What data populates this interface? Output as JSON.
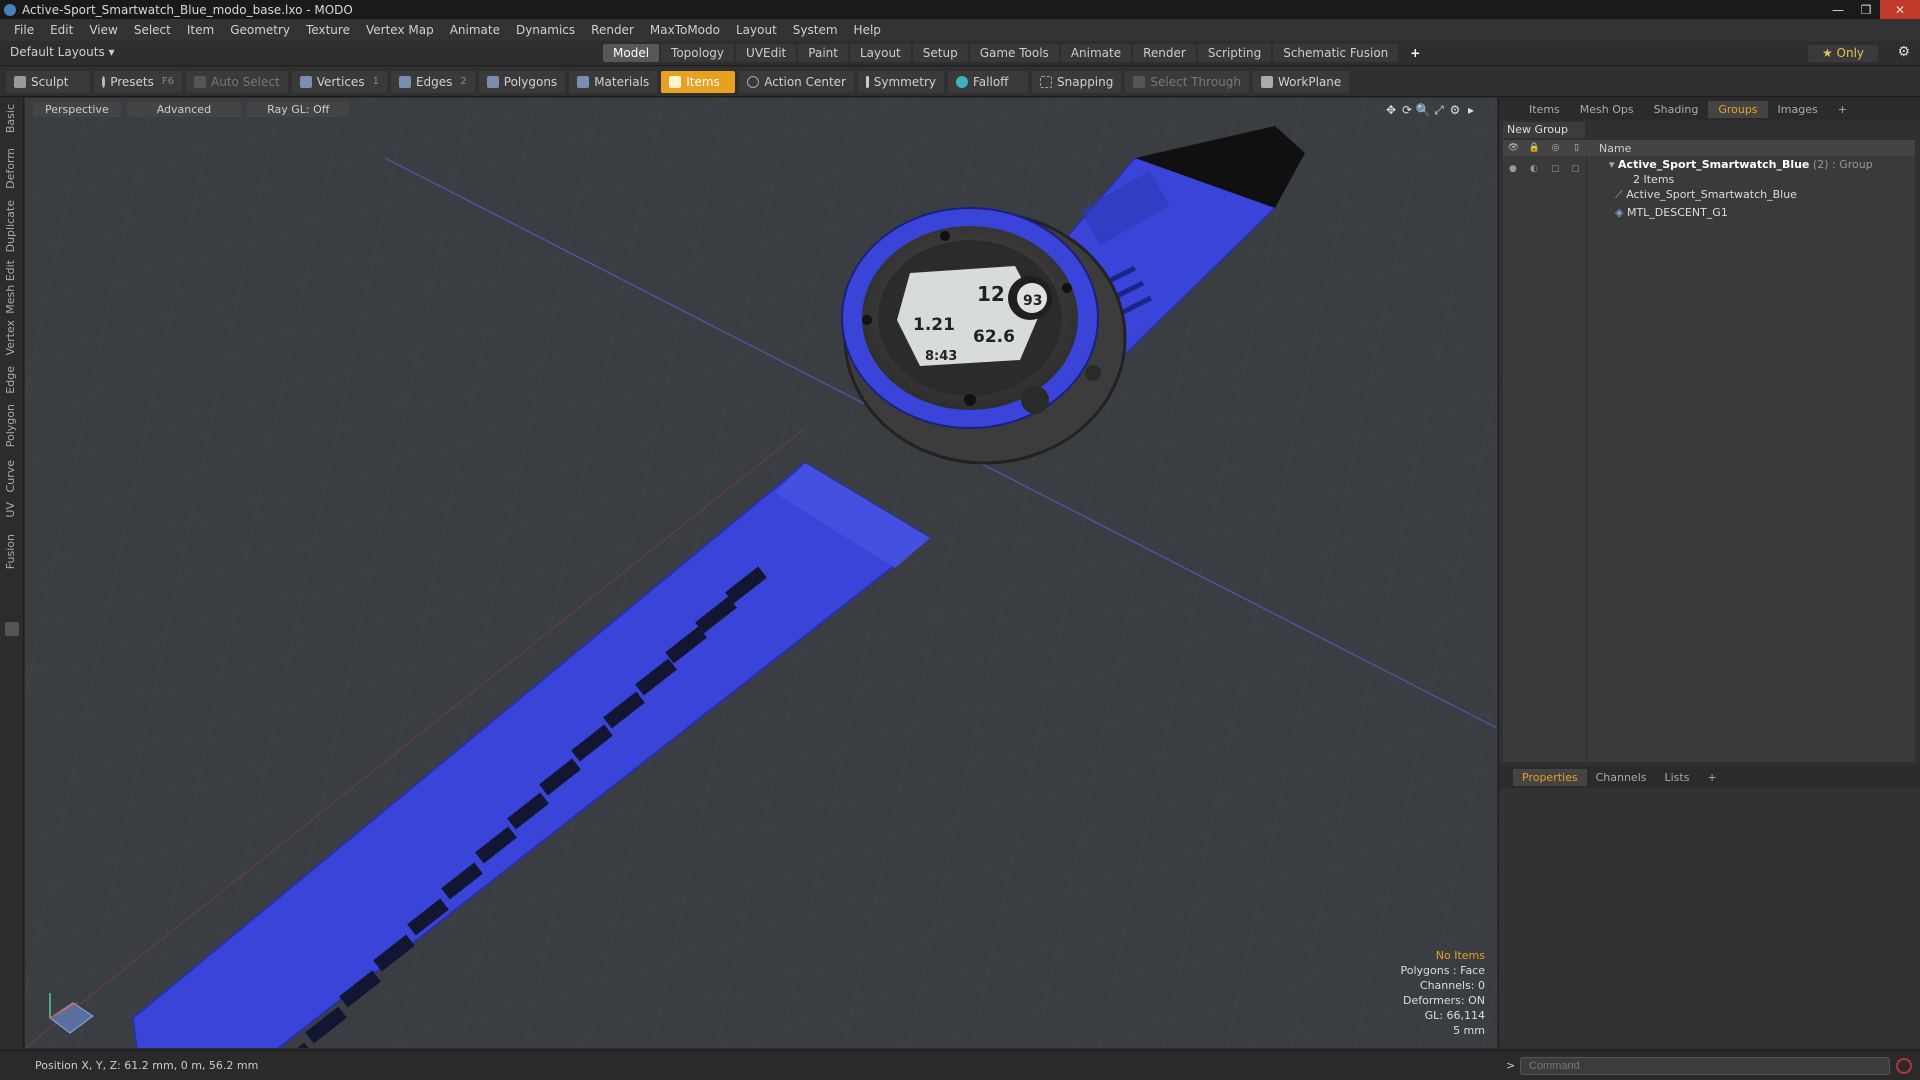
{
  "window": {
    "title": "Active-Sport_Smartwatch_Blue_modo_base.lxo - MODO",
    "controls": [
      "—",
      "❐",
      "✕"
    ]
  },
  "menu": [
    "File",
    "Edit",
    "View",
    "Select",
    "Item",
    "Geometry",
    "Texture",
    "Vertex Map",
    "Animate",
    "Dynamics",
    "Render",
    "MaxToModo",
    "Layout",
    "System",
    "Help"
  ],
  "layout_bar": {
    "layout_select": "Default Layouts ▾",
    "tabs": [
      "Model",
      "Topology",
      "UVEdit",
      "Paint",
      "Layout",
      "Setup",
      "Game Tools",
      "Animate",
      "Render",
      "Scripting",
      "Schematic Fusion"
    ],
    "active_tab": "Model",
    "add_tab": "+",
    "only_label": "★ Only",
    "gear": "⚙"
  },
  "toolbar": {
    "sculpt": "Sculpt",
    "presets": "Presets",
    "presets_key": "F6",
    "auto_select": "Auto Select",
    "vertices": "Vertices",
    "vertices_count": "1",
    "edges": "Edges",
    "edges_count": "2",
    "polygons": "Polygons",
    "materials": "Materials",
    "items": "Items",
    "action_center": "Action Center",
    "symmetry": "Symmetry",
    "falloff": "Falloff",
    "snapping": "Snapping",
    "select_through": "Select Through",
    "workplane": "WorkPlane"
  },
  "left_tabs": [
    "Basic",
    "Deform",
    "Duplicate",
    "Mesh Edit",
    "Vertex",
    "Edge",
    "Polygon",
    "Curve",
    "UV",
    "Fusion"
  ],
  "viewport": {
    "view_mode": "Perspective",
    "shading": "Advanced",
    "raygl": "Ray GL: Off",
    "icons": [
      "✥",
      "⟳",
      "🔍",
      "⤢",
      "⚙",
      "▸"
    ],
    "stats": {
      "selection": "No Items",
      "polygons": "Polygons : Face",
      "channels": "Channels: 0",
      "deformers": "Deformers: ON",
      "gl": "GL: 66,114",
      "grid": "5 mm"
    },
    "watch_face": {
      "top_right": "12",
      "circle": "93",
      "left": "1.21",
      "right": "62.6",
      "bottom": "8:43"
    }
  },
  "right_panel": {
    "tabs": [
      "Items",
      "Mesh Ops",
      "Shading",
      "Groups",
      "Images",
      "+"
    ],
    "active_tab": "Groups",
    "new_group": "New Group",
    "column_name": "Name",
    "column_icons": [
      "👁",
      "🔒",
      "◎",
      "▯"
    ],
    "group": {
      "name": "Active_Sport_Smartwatch_Blue",
      "count": "(2)",
      "type": ": Group",
      "items_label": "2 Items"
    },
    "children": [
      "Active_Sport_Smartwatch_Blue",
      "MTL_DESCENT_G1"
    ],
    "bottom_tabs": [
      "Properties",
      "Channels",
      "Lists",
      "+"
    ],
    "bottom_active": "Properties"
  },
  "status": {
    "position": "Position X, Y, Z:  61.2 mm, 0 m, 56.2 mm",
    "command_placeholder": "Command",
    "prompt": ">"
  },
  "colors": {
    "accent": "#e8a020",
    "strap": "#3a44d8",
    "viewport_bg": "#3a3e42"
  }
}
